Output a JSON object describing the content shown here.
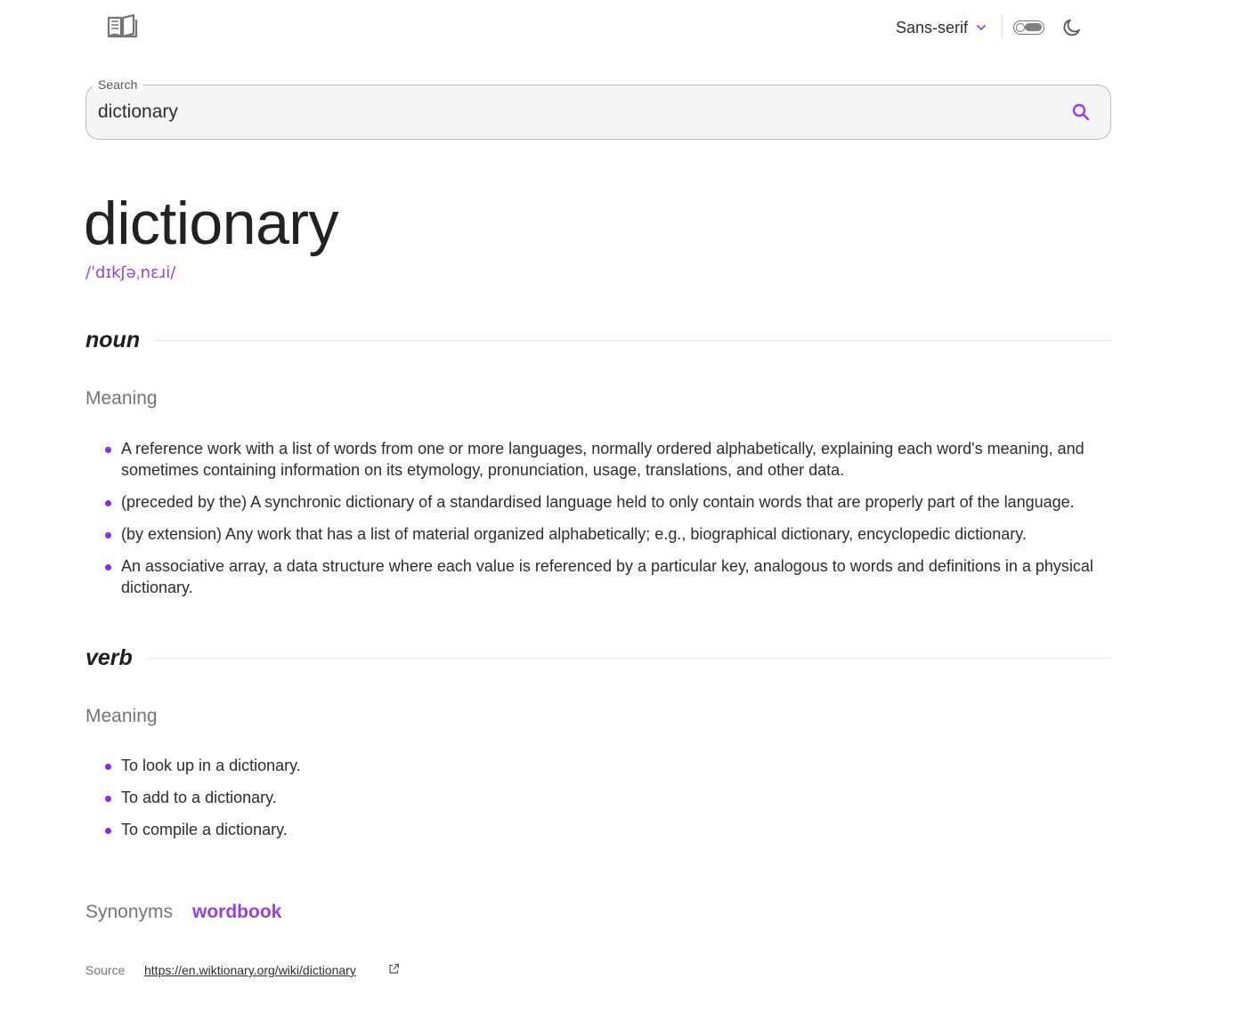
{
  "header": {
    "font_select": {
      "value": "Sans-serif"
    },
    "theme_toggle": {
      "state": "off"
    }
  },
  "search": {
    "legend": "Search",
    "value": "dictionary",
    "placeholder": ""
  },
  "entry": {
    "word": "dictionary",
    "phonetic": "/ˈdɪkʃəˌnɛɹi/",
    "meanings": [
      {
        "part_of_speech": "noun",
        "label": "Meaning",
        "definitions": [
          "A reference work with a list of words from one or more languages, normally ordered alphabetically, explaining each word's meaning, and sometimes containing information on its etymology, pronunciation, usage, translations, and other data.",
          "(preceded by the) A synchronic dictionary of a standardised language held to only contain words that are properly part of the language.",
          "(by extension) Any work that has a list of material organized alphabetically; e.g., biographical dictionary, encyclopedic dictionary.",
          "An associative array, a data structure where each value is referenced by a particular key, analogous to words and definitions in a physical dictionary."
        ]
      },
      {
        "part_of_speech": "verb",
        "label": "Meaning",
        "definitions": [
          "To look up in a dictionary.",
          "To add to a dictionary.",
          "To compile a dictionary."
        ]
      }
    ],
    "synonyms_label": "Synonyms",
    "synonyms": [
      "wordbook"
    ],
    "source_label": "Source",
    "source_url": "https://en.wiktionary.org/wiki/dictionary"
  },
  "colors": {
    "accent": "#9a3ee0",
    "bullet": "#8a2be2",
    "text": "#2d2d2d",
    "muted": "#757575"
  },
  "icons": [
    "book-icon",
    "chevron-down-icon",
    "moon-icon",
    "search-icon",
    "external-link-icon"
  ]
}
